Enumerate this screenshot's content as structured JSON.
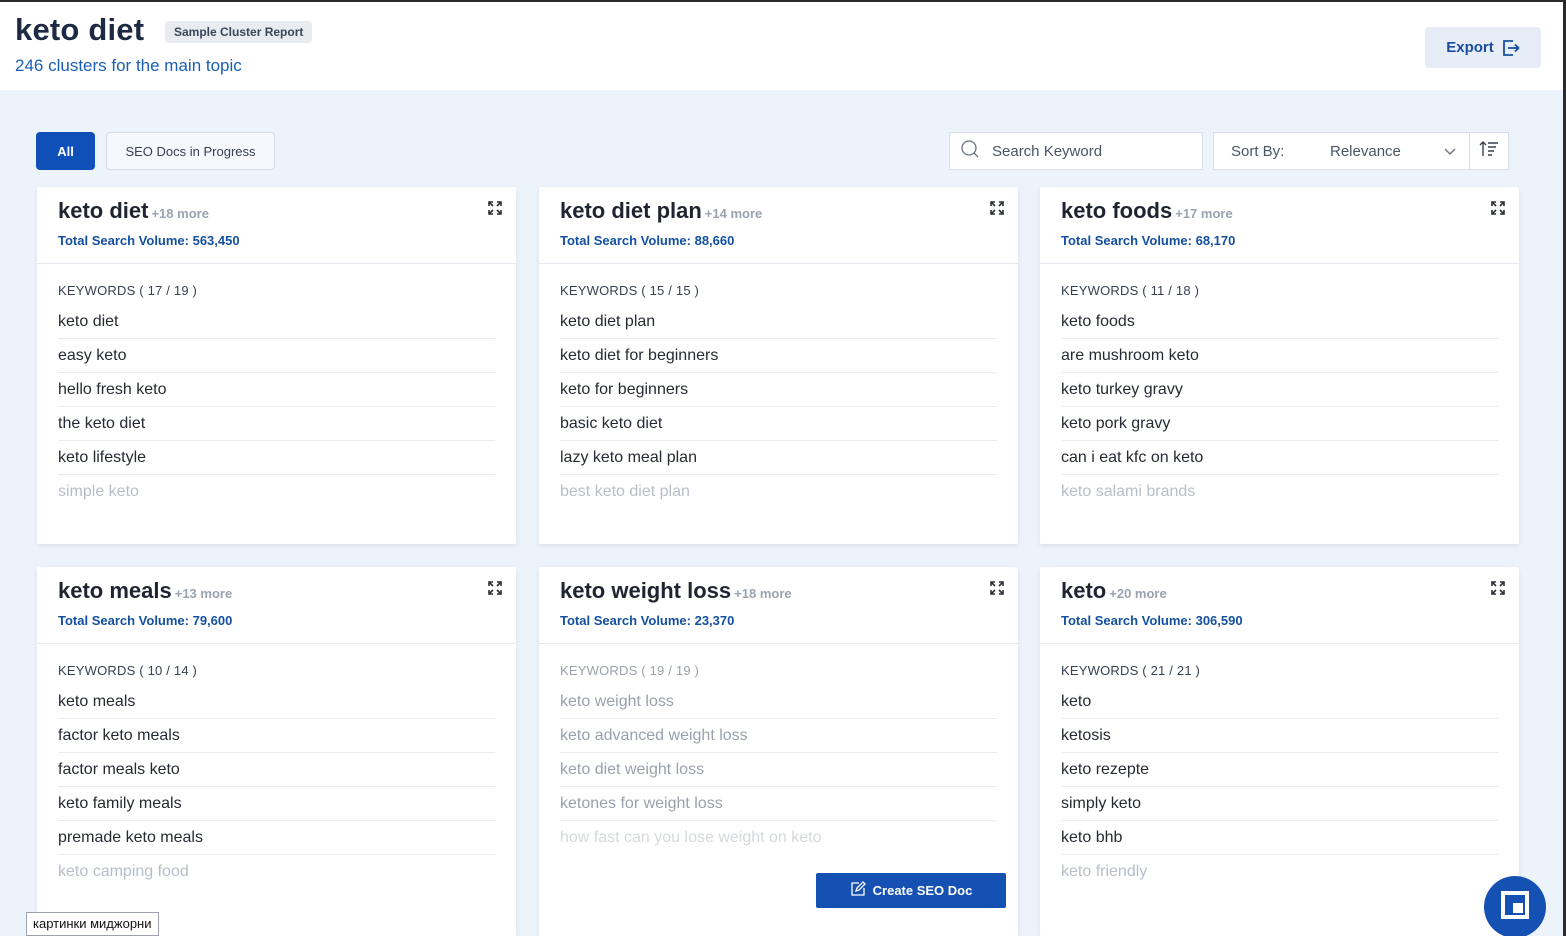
{
  "header": {
    "title": "keto diet",
    "badge": "Sample Cluster Report",
    "subtitle": "246 clusters for the main topic",
    "export_label": "Export"
  },
  "tabs": [
    {
      "label": "All",
      "active": true
    },
    {
      "label": "SEO Docs in Progress",
      "active": false
    }
  ],
  "search": {
    "placeholder": "Search Keyword"
  },
  "sort": {
    "label": "Sort By:",
    "value": "Relevance"
  },
  "colors": {
    "primary": "#1451b3",
    "accent_text": "#14509f",
    "background": "#edf3fb"
  },
  "cards": [
    {
      "title": "keto diet",
      "more": "+18 more",
      "volume": "Total Search Volume: 563,450",
      "keywords_label": "KEYWORDS ( 17 / 19 )",
      "keywords": [
        "keto diet",
        "easy keto",
        "hello fresh keto",
        "the keto diet",
        "keto lifestyle",
        "simple keto"
      ]
    },
    {
      "title": "keto diet plan",
      "more": "+14 more",
      "volume": "Total Search Volume: 88,660",
      "keywords_label": "KEYWORDS ( 15 / 15 )",
      "keywords": [
        "keto diet plan",
        "keto diet for beginners",
        "keto for beginners",
        "basic keto diet",
        "lazy keto meal plan",
        "best keto diet plan"
      ]
    },
    {
      "title": "keto foods",
      "more": "+17 more",
      "volume": "Total Search Volume: 68,170",
      "keywords_label": "KEYWORDS ( 11 / 18 )",
      "keywords": [
        "keto foods",
        "are mushroom keto",
        "keto turkey gravy",
        "keto pork gravy",
        "can i eat kfc on keto",
        "keto salami brands"
      ]
    },
    {
      "title": "keto meals",
      "more": "+13 more",
      "volume": "Total Search Volume: 79,600",
      "keywords_label": "KEYWORDS ( 10 / 14 )",
      "keywords": [
        "keto meals",
        "factor keto meals",
        "factor meals keto",
        "keto family meals",
        "premade keto meals",
        "keto camping food"
      ]
    },
    {
      "title": "keto weight loss",
      "more": "+18 more",
      "volume": "Total Search Volume: 23,370",
      "keywords_label": "KEYWORDS ( 19 / 19 )",
      "keywords": [
        "keto weight loss",
        "keto advanced weight loss",
        "keto diet weight loss",
        "ketones for weight loss",
        "how fast can you lose weight on keto"
      ]
    },
    {
      "title": "keto",
      "more": "+20 more",
      "volume": "Total Search Volume: 306,590",
      "keywords_label": "KEYWORDS ( 21 / 21 )",
      "keywords": [
        "keto",
        "ketosis",
        "keto rezepte",
        "simply keto",
        "keto bhb",
        "keto friendly"
      ]
    }
  ],
  "create_button_label": "Create SEO Doc",
  "watermark_text": "картинки миджорни"
}
